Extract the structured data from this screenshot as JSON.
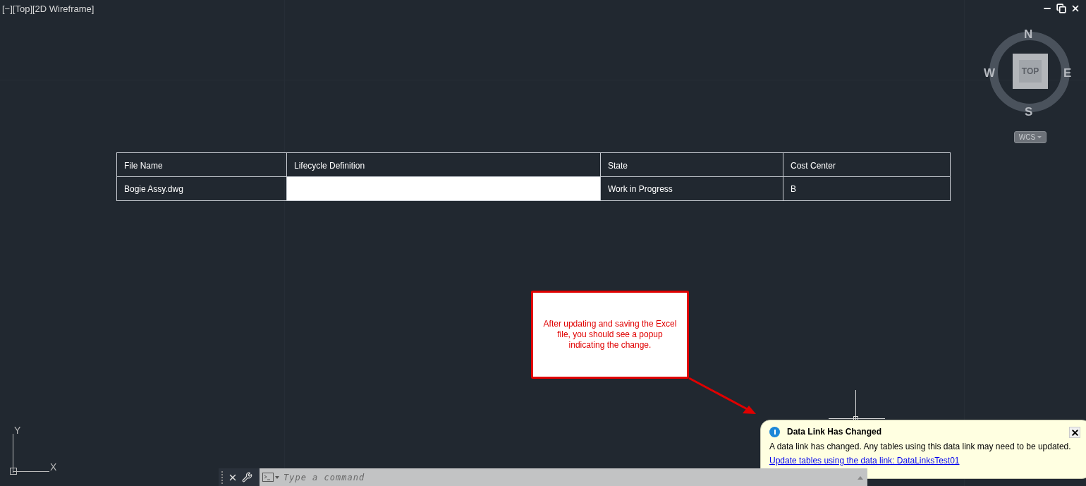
{
  "viewport_label": "[−][Top][2D Wireframe]",
  "viewcube": {
    "north": "N",
    "south": "S",
    "east": "E",
    "west": "W",
    "face": "TOP",
    "wcs": "WCS"
  },
  "table": {
    "columns": [
      "File Name",
      "Lifecycle Definition",
      "State",
      "Cost Center"
    ],
    "rows": [
      {
        "cells": [
          {
            "text": "Bogie Assy.dwg",
            "selected": false
          },
          {
            "selected": true
          },
          {
            "text": "Work in Progress",
            "selected": false
          },
          {
            "text": "B",
            "selected": false
          }
        ]
      }
    ]
  },
  "callout": {
    "text": "After updating and saving the Excel file, you should see a popup indicating the change."
  },
  "notification": {
    "title": "Data Link Has Changed",
    "message": "A data link has changed.  Any tables using this data link may need to be updated.",
    "link": "Update tables using the data link: DataLinksTest01"
  },
  "command_line": {
    "placeholder": "Type a command"
  },
  "ucs": {
    "x": "X",
    "y": "Y"
  }
}
